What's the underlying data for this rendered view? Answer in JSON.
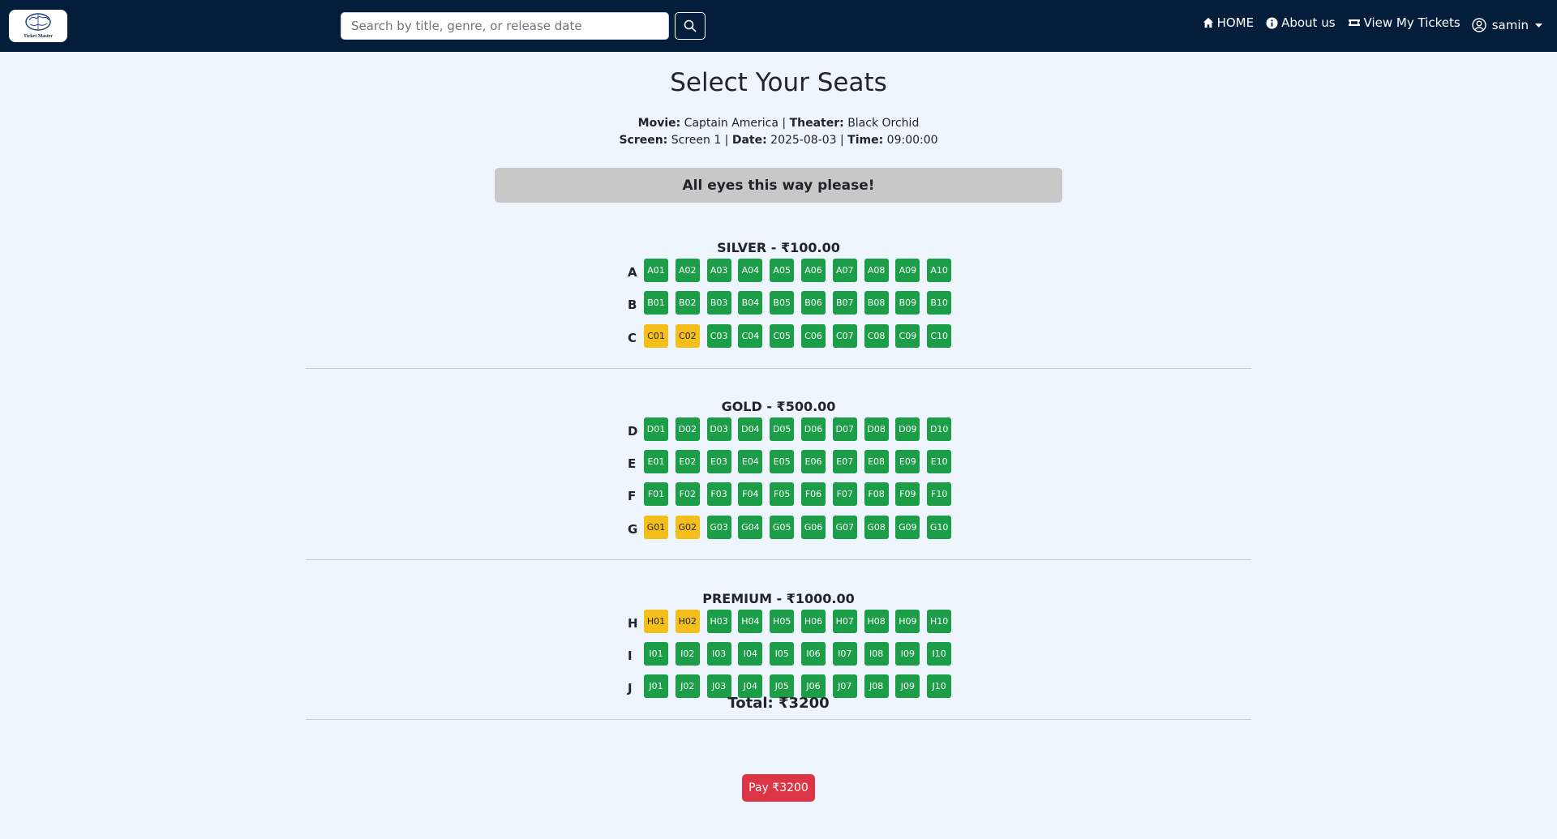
{
  "navbar": {
    "logo_text": "Ticket Master",
    "search_placeholder": "Search by title, genre, or release date",
    "search_value": "",
    "home_label": "HOME",
    "about_label": "About us",
    "tickets_label": "View My Tickets",
    "user_name": "samin"
  },
  "page": {
    "title": "Select Your Seats",
    "movie_label": "Movie:",
    "movie": "Captain America",
    "theater_label": "Theater:",
    "theater": "Black Orchid",
    "screen_label": "Screen:",
    "screen": "Screen 1",
    "date_label": "Date:",
    "date": "2025-08-03",
    "time_label": "Time:",
    "time": "09:00:00",
    "banner": "All eyes this way please!"
  },
  "sections": [
    {
      "title": "SILVER - ₹100.00",
      "rows": [
        {
          "label": "A",
          "seats": [
            [
              "A01",
              false
            ],
            [
              "A02",
              false
            ],
            [
              "A03",
              false
            ],
            [
              "A04",
              false
            ],
            [
              "A05",
              false
            ],
            [
              "A06",
              false
            ],
            [
              "A07",
              false
            ],
            [
              "A08",
              false
            ],
            [
              "A09",
              false
            ],
            [
              "A10",
              false
            ]
          ]
        },
        {
          "label": "B",
          "seats": [
            [
              "B01",
              false
            ],
            [
              "B02",
              false
            ],
            [
              "B03",
              false
            ],
            [
              "B04",
              false
            ],
            [
              "B05",
              false
            ],
            [
              "B06",
              false
            ],
            [
              "B07",
              false
            ],
            [
              "B08",
              false
            ],
            [
              "B09",
              false
            ],
            [
              "B10",
              false
            ]
          ]
        },
        {
          "label": "C",
          "seats": [
            [
              "C01",
              true
            ],
            [
              "C02",
              true
            ],
            [
              "C03",
              false
            ],
            [
              "C04",
              false
            ],
            [
              "C05",
              false
            ],
            [
              "C06",
              false
            ],
            [
              "C07",
              false
            ],
            [
              "C08",
              false
            ],
            [
              "C09",
              false
            ],
            [
              "C10",
              false
            ]
          ]
        }
      ]
    },
    {
      "title": "GOLD - ₹500.00",
      "rows": [
        {
          "label": "D",
          "seats": [
            [
              "D01",
              false
            ],
            [
              "D02",
              false
            ],
            [
              "D03",
              false
            ],
            [
              "D04",
              false
            ],
            [
              "D05",
              false
            ],
            [
              "D06",
              false
            ],
            [
              "D07",
              false
            ],
            [
              "D08",
              false
            ],
            [
              "D09",
              false
            ],
            [
              "D10",
              false
            ]
          ]
        },
        {
          "label": "E",
          "seats": [
            [
              "E01",
              false
            ],
            [
              "E02",
              false
            ],
            [
              "E03",
              false
            ],
            [
              "E04",
              false
            ],
            [
              "E05",
              false
            ],
            [
              "E06",
              false
            ],
            [
              "E07",
              false
            ],
            [
              "E08",
              false
            ],
            [
              "E09",
              false
            ],
            [
              "E10",
              false
            ]
          ]
        },
        {
          "label": "F",
          "seats": [
            [
              "F01",
              false
            ],
            [
              "F02",
              false
            ],
            [
              "F03",
              false
            ],
            [
              "F04",
              false
            ],
            [
              "F05",
              false
            ],
            [
              "F06",
              false
            ],
            [
              "F07",
              false
            ],
            [
              "F08",
              false
            ],
            [
              "F09",
              false
            ],
            [
              "F10",
              false
            ]
          ]
        },
        {
          "label": "G",
          "seats": [
            [
              "G01",
              true
            ],
            [
              "G02",
              true
            ],
            [
              "G03",
              false
            ],
            [
              "G04",
              false
            ],
            [
              "G05",
              false
            ],
            [
              "G06",
              false
            ],
            [
              "G07",
              false
            ],
            [
              "G08",
              false
            ],
            [
              "G09",
              false
            ],
            [
              "G10",
              false
            ]
          ]
        }
      ]
    },
    {
      "title": "PREMIUM - ₹1000.00",
      "rows": [
        {
          "label": "H",
          "seats": [
            [
              "H01",
              true
            ],
            [
              "H02",
              true
            ],
            [
              "H03",
              false
            ],
            [
              "H04",
              false
            ],
            [
              "H05",
              false
            ],
            [
              "H06",
              false
            ],
            [
              "H07",
              false
            ],
            [
              "H08",
              false
            ],
            [
              "H09",
              false
            ],
            [
              "H10",
              false
            ]
          ]
        },
        {
          "label": "I",
          "seats": [
            [
              "I01",
              false
            ],
            [
              "I02",
              false
            ],
            [
              "I03",
              false
            ],
            [
              "I04",
              false
            ],
            [
              "I05",
              false
            ],
            [
              "I06",
              false
            ],
            [
              "I07",
              false
            ],
            [
              "I08",
              false
            ],
            [
              "I09",
              false
            ],
            [
              "I10",
              false
            ]
          ]
        },
        {
          "label": "J",
          "seats": [
            [
              "J01",
              false
            ],
            [
              "J02",
              false
            ],
            [
              "J03",
              false
            ],
            [
              "J04",
              false
            ],
            [
              "J05",
              false
            ],
            [
              "J06",
              false
            ],
            [
              "J07",
              false
            ],
            [
              "J08",
              false
            ],
            [
              "J09",
              false
            ],
            [
              "J10",
              false
            ]
          ]
        }
      ]
    }
  ],
  "footer": {
    "total": "Total: ₹3200",
    "pay_label": "Pay ₹3200"
  },
  "colors": {
    "navbar": "#031d3b",
    "page_bg": "#eef5fd",
    "seat_available": "#1c9e48",
    "seat_selected": "#f4be1b",
    "pay_button": "#dc3545",
    "banner": "#c8c8c8"
  },
  "icons": {
    "search": "search-icon",
    "home": "home-icon",
    "about": "info-icon",
    "tickets": "ticket-icon",
    "user": "user-circle-icon",
    "caret": "caret-down-icon"
  }
}
